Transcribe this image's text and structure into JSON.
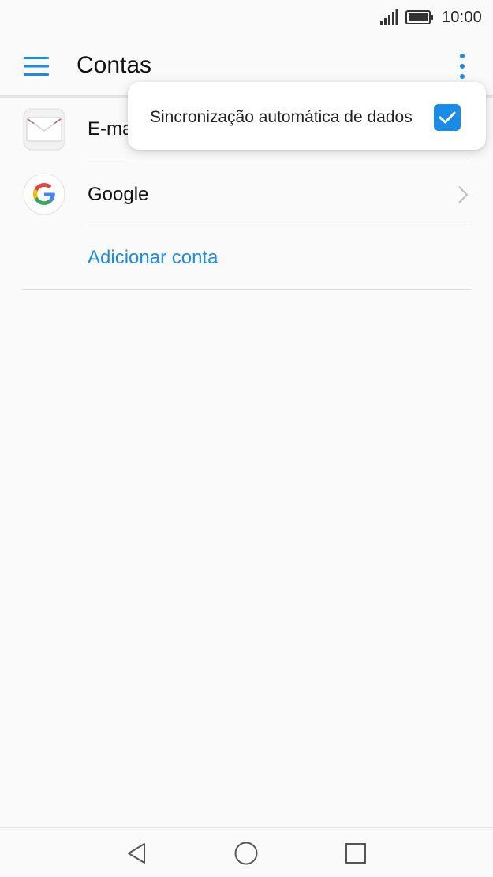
{
  "status_bar": {
    "time": "10:00",
    "icons": [
      "signal-icon",
      "battery-icon"
    ]
  },
  "app_bar": {
    "title": "Contas",
    "menu_icon": "hamburger-menu-icon",
    "overflow_icon": "more-vertical-icon"
  },
  "accounts": [
    {
      "label": "E-mail",
      "icon": "email-envelope-icon",
      "has_chevron": false
    },
    {
      "label": "Google",
      "icon": "google-g-icon",
      "has_chevron": true
    }
  ],
  "add_account_label": "Adicionar conta",
  "popup_menu": {
    "items": [
      {
        "label": "Sincronização automática de dados",
        "checked": true
      }
    ]
  },
  "nav_bar": {
    "icons": [
      "back-triangle-icon",
      "home-circle-icon",
      "recents-square-icon"
    ]
  },
  "colors": {
    "accent": "#1a8ce6",
    "background": "#fafafa",
    "text": "#1a1a1a"
  }
}
